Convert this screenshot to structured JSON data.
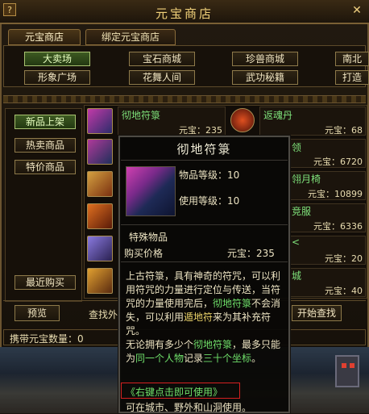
{
  "window": {
    "title": "元宝商店",
    "help_label": "?",
    "close_label": "✕"
  },
  "tabs": [
    "元宝商店",
    "绑定元宝商店"
  ],
  "categories_row1": [
    "大卖场",
    "宝石商城",
    "珍兽商城",
    "南北"
  ],
  "categories_row2": [
    "形象广场",
    "花舞人间",
    "武功秘籍",
    "打造"
  ],
  "sidebar": {
    "items": [
      "新品上架",
      "热卖商品",
      "特价商品"
    ],
    "recent": "最近购买"
  },
  "items": [
    {
      "name": "彻地符箓",
      "price_label": "元宝：",
      "price": "235"
    },
    {
      "name": "返魂丹",
      "price_label": "元宝：",
      "price": "68"
    },
    {
      "name": "",
      "price_label": "元宝：",
      "price": "6720"
    },
    {
      "name": "翎月椅",
      "price_label": "元宝：",
      "price": "10899"
    },
    {
      "name": "竞服",
      "price_label": "元宝：",
      "price": "6336"
    },
    {
      "name": "",
      "price_label": "元宝：",
      "price": "20"
    },
    {
      "name": "",
      "price_label": "元宝：",
      "price": "40"
    }
  ],
  "frag": {
    "a": "领",
    "b": "<",
    "c": "城"
  },
  "bottom": {
    "preview": "预览",
    "search_label": "查找外",
    "start_search": "开始查找"
  },
  "status": {
    "carry": "携带元宝数量：0"
  },
  "tooltip": {
    "title": "彻地符箓",
    "item_level_label": "物品等级：",
    "item_level": "10",
    "use_level_label": "使用等级：",
    "use_level": "10",
    "type": "特殊物品",
    "buy_label": "购买价格",
    "buy_price": "元宝：235",
    "d1": "上古符箓，具有神奇的符咒，可以利用符咒的力量进行定位与传送，当符咒的力量使用完后，",
    "d1g": "彻地符箓",
    "d1b": "不会消失，可以利用",
    "d1y": "遁地符",
    "d1c": "来为其补充符咒。",
    "d2a": "无论拥有多少个",
    "d2g": "彻地符箓",
    "d2b": "，最多只能为",
    "d2g2": "同一个人物",
    "d2c": "记录",
    "d2g3": "三十个坐标",
    "d2d": "。",
    "usage": "《右键点击即可使用》",
    "location": "可在城市、野外和山洞使用。"
  },
  "colors": {
    "accent": "#f2d27a",
    "highlight_green": "#6fe06a",
    "highlight_yellow": "#ecd46a",
    "usage_border": "#d42020"
  }
}
